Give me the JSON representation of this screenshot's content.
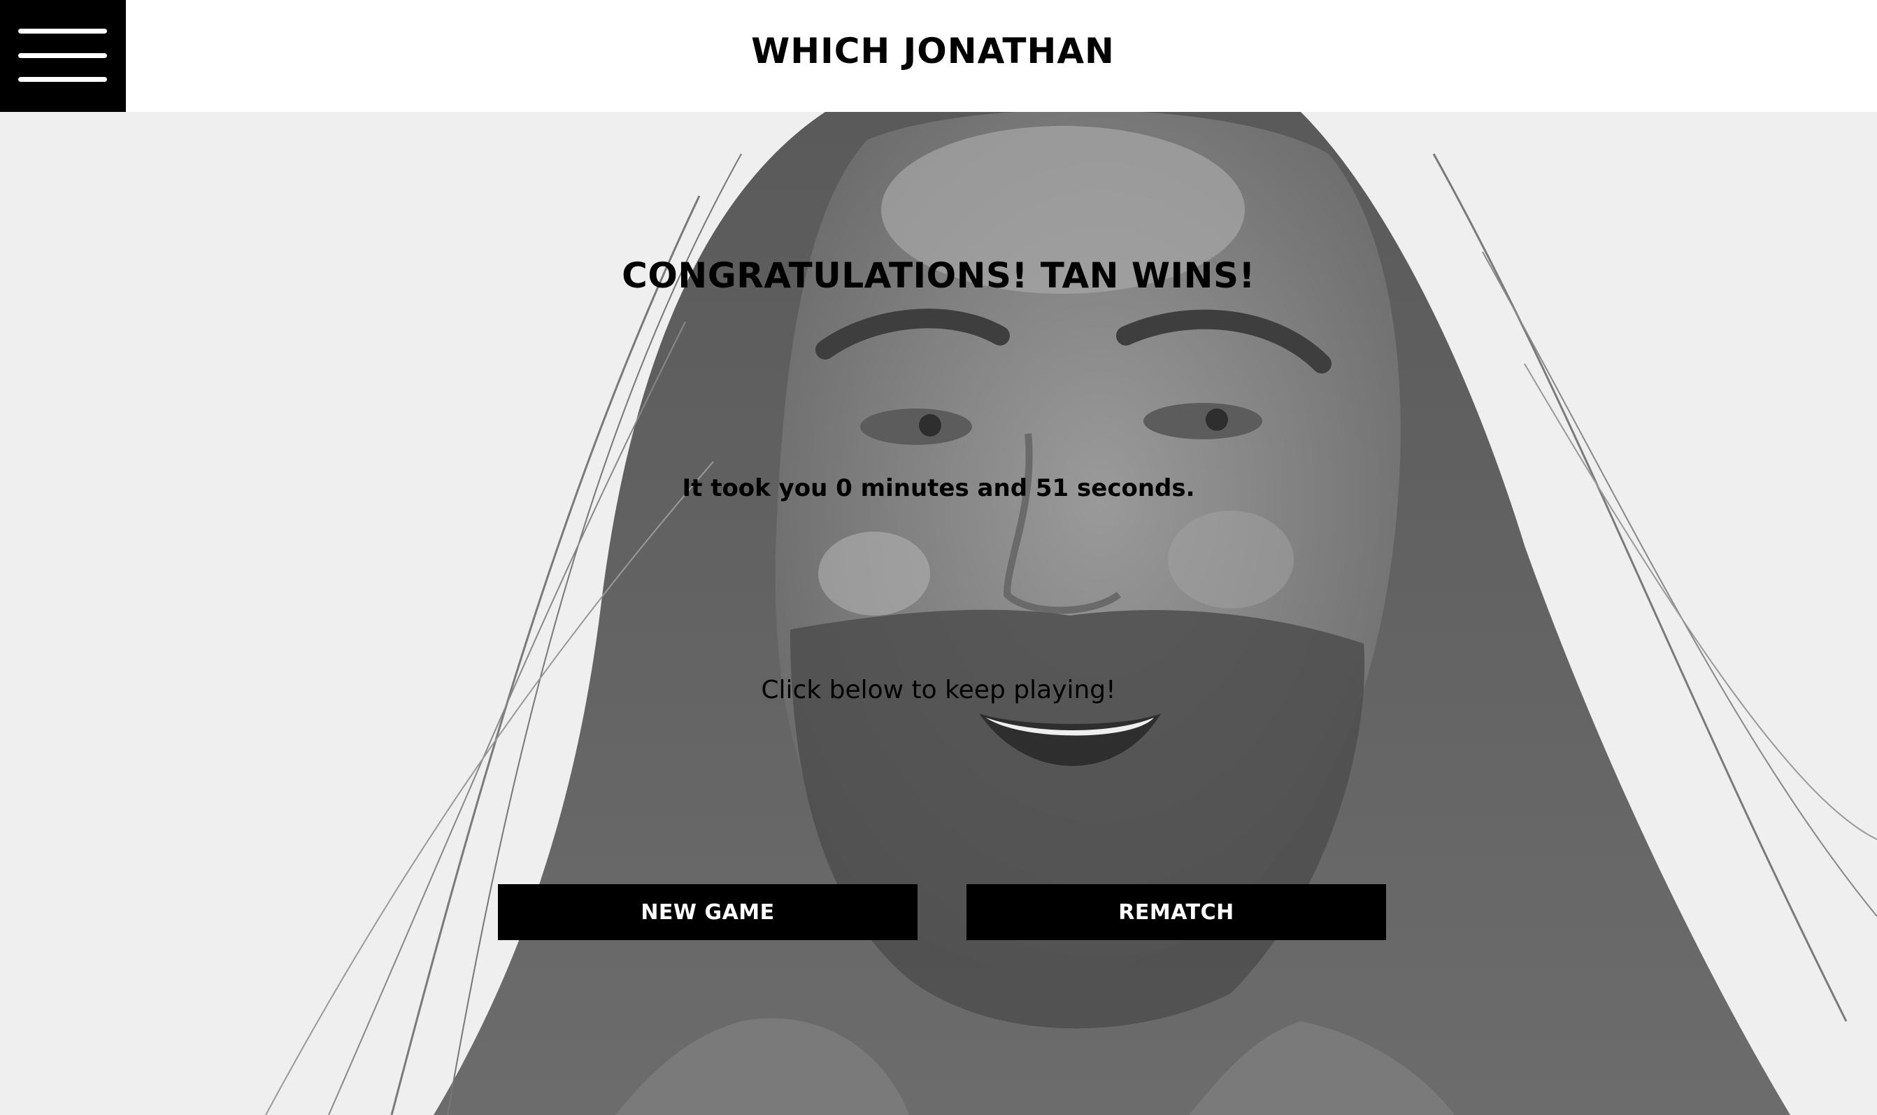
{
  "header": {
    "title": "WHICH JONATHAN",
    "menu_icon": "hamburger-menu-icon"
  },
  "result": {
    "title": "CONGRATULATIONS! TAN WINS!",
    "time_message": "It took you 0 minutes and 51 seconds.",
    "prompt": "Click below to keep playing!"
  },
  "actions": {
    "new_game_label": "NEW GAME",
    "rematch_label": "REMATCH"
  },
  "colors": {
    "header_bg": "#ffffff",
    "menu_bg": "#000000",
    "button_bg": "#000000",
    "button_text": "#ffffff",
    "text": "#000000"
  }
}
